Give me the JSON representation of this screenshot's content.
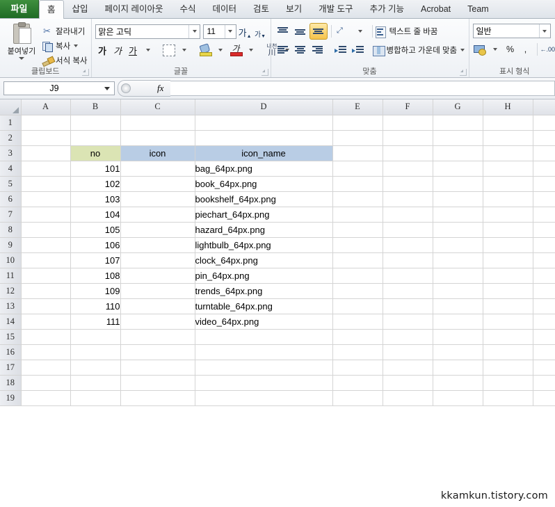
{
  "ribbon": {
    "file_tab": "파일",
    "tabs": [
      {
        "label": "홈",
        "active": true
      },
      {
        "label": "삽입",
        "active": false
      },
      {
        "label": "페이지 레이아웃",
        "active": false
      },
      {
        "label": "수식",
        "active": false
      },
      {
        "label": "데이터",
        "active": false
      },
      {
        "label": "검토",
        "active": false
      },
      {
        "label": "보기",
        "active": false
      },
      {
        "label": "개발 도구",
        "active": false
      },
      {
        "label": "추가 기능",
        "active": false
      },
      {
        "label": "Acrobat",
        "active": false
      },
      {
        "label": "Team",
        "active": false
      }
    ],
    "clipboard": {
      "group_label": "클립보드",
      "paste_label": "붙여넣기",
      "cut_label": "잘라내기",
      "copy_label": "복사",
      "format_painter_label": "서식 복사"
    },
    "font": {
      "group_label": "글꼴",
      "font_name": "맑은 고딕",
      "font_size": "11",
      "grow_font": "가",
      "shrink_font": "가",
      "bold": "가",
      "italic": "가",
      "underline": "가",
      "phonetic_top": "내천",
      "phonetic_bottom": "川"
    },
    "alignment": {
      "group_label": "맞춤",
      "wrap_text_label": "텍스트 줄 바꿈",
      "merge_center_label": "병합하고 가운데 맞춤"
    },
    "number": {
      "group_label": "표시 형식",
      "format_value": "일반",
      "percent": "%",
      "comma": ",",
      "decimal_icon": ".00"
    }
  },
  "formula_bar": {
    "name_box_value": "J9",
    "fx_label": "fx",
    "formula_value": ""
  },
  "sheet": {
    "columns": [
      "A",
      "B",
      "C",
      "D",
      "E",
      "F",
      "G",
      "H"
    ],
    "rows": [
      "1",
      "2",
      "3",
      "4",
      "5",
      "6",
      "7",
      "8",
      "9",
      "10",
      "11",
      "12",
      "13",
      "14",
      "15",
      "16",
      "17",
      "18",
      "19"
    ],
    "header_row_index": 2,
    "header_cells": {
      "B": "no",
      "C": "icon",
      "D": "icon_name"
    },
    "colors": {
      "header_olive": "#dbe4b4",
      "header_blue": "#b9cde5"
    },
    "data": [
      {
        "row": "4",
        "no": "101",
        "icon": "",
        "icon_name": "bag_64px.png"
      },
      {
        "row": "5",
        "no": "102",
        "icon": "",
        "icon_name": "book_64px.png"
      },
      {
        "row": "6",
        "no": "103",
        "icon": "",
        "icon_name": "bookshelf_64px.png"
      },
      {
        "row": "7",
        "no": "104",
        "icon": "",
        "icon_name": "piechart_64px.png"
      },
      {
        "row": "8",
        "no": "105",
        "icon": "",
        "icon_name": "hazard_64px.png"
      },
      {
        "row": "9",
        "no": "106",
        "icon": "",
        "icon_name": "lightbulb_64px.png"
      },
      {
        "row": "10",
        "no": "107",
        "icon": "",
        "icon_name": "clock_64px.png"
      },
      {
        "row": "11",
        "no": "108",
        "icon": "",
        "icon_name": "pin_64px.png"
      },
      {
        "row": "12",
        "no": "109",
        "icon": "",
        "icon_name": "trends_64px.png"
      },
      {
        "row": "13",
        "no": "110",
        "icon": "",
        "icon_name": "turntable_64px.png"
      },
      {
        "row": "14",
        "no": "111",
        "icon": "",
        "icon_name": "video_64px.png"
      }
    ]
  },
  "watermark": "kkamkun.tistory.com"
}
